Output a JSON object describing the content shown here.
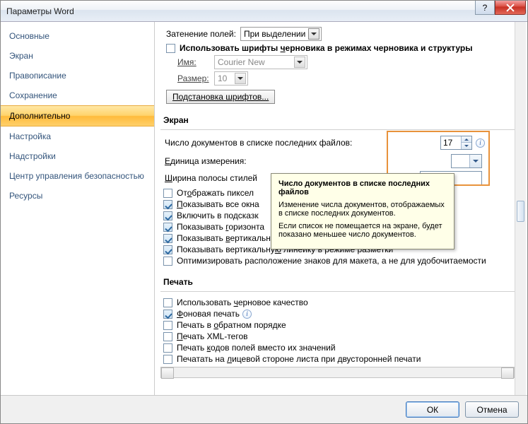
{
  "window": {
    "title": "Параметры Word"
  },
  "sidebar": {
    "items": [
      {
        "label": "Основные"
      },
      {
        "label": "Экран"
      },
      {
        "label": "Правописание"
      },
      {
        "label": "Сохранение"
      },
      {
        "label": "Дополнительно"
      },
      {
        "label": "Настройка"
      },
      {
        "label": "Надстройки"
      },
      {
        "label": "Центр управления безопасностью"
      },
      {
        "label": "Ресурсы"
      }
    ],
    "selected_index": 4
  },
  "shading": {
    "label": "Затенение полей:",
    "value": "При выделении"
  },
  "draft_fonts": {
    "checkbox_label_pre": "Использовать шрифты ",
    "checkbox_label_u": "ч",
    "checkbox_label_post": "ерновика в режимах черновика и структуры",
    "checked": false,
    "name_label": "Имя:",
    "name_value": "Courier New",
    "size_label": "Размер:",
    "size_value": "10"
  },
  "font_sub_btn": "Подстановка шрифтов...",
  "screen_section": {
    "header": "Экран",
    "recent_label": "Число документов в списке последних файлов:",
    "recent_value": "17",
    "units_label_pre": "",
    "units_label_u": "Е",
    "units_label_post": "диница измерения:",
    "stylewidth_label_pre": "",
    "stylewidth_label_u": "Ш",
    "stylewidth_label_post": "ирина полосы стилей",
    "checks": [
      {
        "checked": false,
        "pre": "От",
        "u": "о",
        "post": "бражать пиксел"
      },
      {
        "checked": true,
        "pre": "",
        "u": "П",
        "post": "оказывать все окна"
      },
      {
        "checked": true,
        "pre": "Включить в подсказк",
        "u": "",
        "post": ""
      },
      {
        "checked": true,
        "pre": "Показывать ",
        "u": "г",
        "post": "оризонта"
      },
      {
        "checked": true,
        "pre": "Показывать ",
        "u": "в",
        "post": "ертикальную полосу прокрутки"
      },
      {
        "checked": true,
        "pre": "Показывать вертикальну",
        "u": "ю",
        "post": " линейку в режиме разметки"
      },
      {
        "checked": false,
        "pre": "Оптимизировать расположение знаков для макета, а не для удобочитаемости",
        "u": "",
        "post": ""
      }
    ]
  },
  "print_section": {
    "header": "Печать",
    "checks": [
      {
        "checked": false,
        "pre": "Использовать ",
        "u": "ч",
        "post": "ерновое качество"
      },
      {
        "checked": true,
        "pre": "",
        "u": "Ф",
        "post": "оновая печать",
        "info": true
      },
      {
        "checked": false,
        "pre": "Печать в ",
        "u": "о",
        "post": "братном порядке"
      },
      {
        "checked": false,
        "pre": "",
        "u": "П",
        "post": "ечать XML-тегов"
      },
      {
        "checked": false,
        "pre": "Печать ",
        "u": "к",
        "post": "одов полей вместо их значений"
      },
      {
        "checked": false,
        "pre": "Печатать на ",
        "u": "л",
        "post": "ицевой стороне листа при двусторонней печати"
      }
    ]
  },
  "tooltip": {
    "title": "Число документов в списке последних файлов",
    "p1": "Изменение числа документов, отображаемых в списке последних документов.",
    "p2": "Если список не помещается на экране, будет показано меньшее число документов."
  },
  "buttons": {
    "ok": "ОК",
    "cancel": "Отмена"
  },
  "help_glyph": "?"
}
